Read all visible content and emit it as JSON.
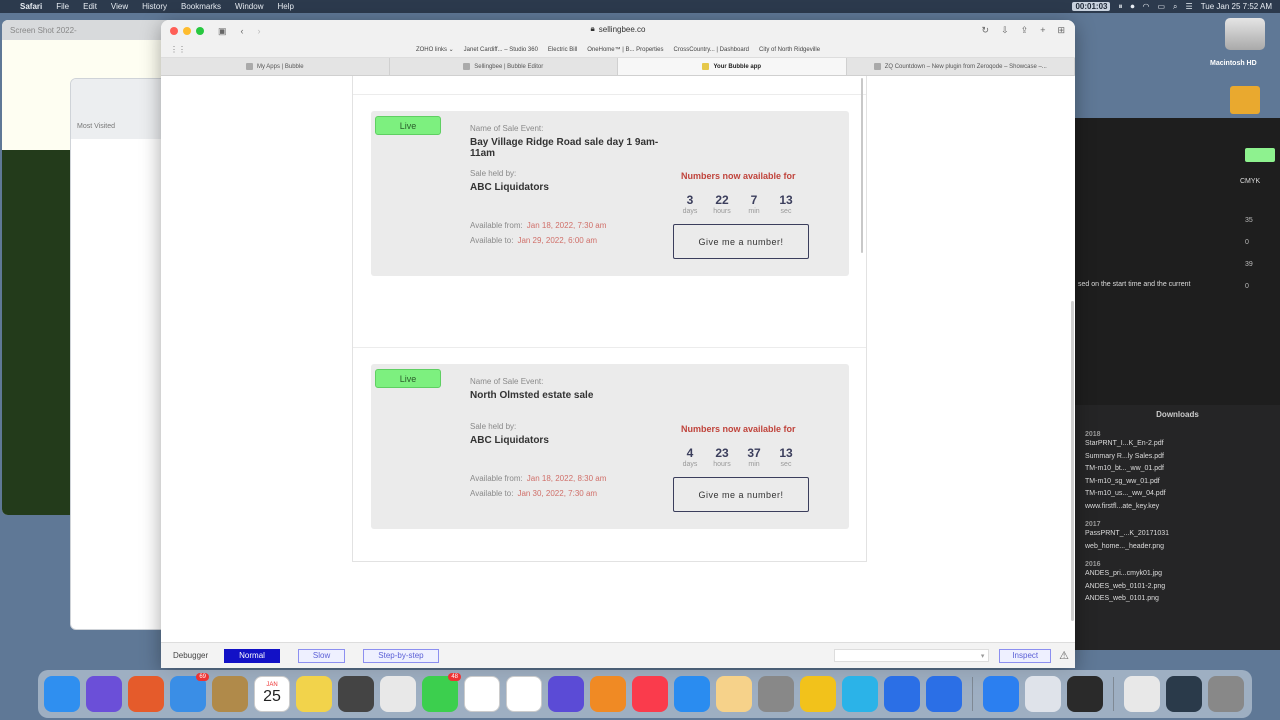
{
  "menubar": {
    "app": "Safari",
    "items": [
      "File",
      "Edit",
      "View",
      "History",
      "Bookmarks",
      "Window",
      "Help"
    ],
    "recording_time": "00:01:03",
    "clock": "Tue Jan 25  7:52 AM"
  },
  "desktop": {
    "bg_window_title": "Screen Shot 2022-",
    "bg_window_tab": "Most Visited",
    "disk_label": "Macintosh HD",
    "right_panel_text": "sed on the start time and the current",
    "cmyk_label": "CMYK",
    "right_numbers": [
      "35",
      "0",
      "39",
      "0"
    ],
    "downloads": {
      "title": "Downloads",
      "groups": [
        {
          "year": "2018",
          "files": [
            "StarPRNT_I...K_En-2.pdf",
            "Summary R...ly Sales.pdf",
            "TM-m10_bt..._ww_01.pdf",
            "TM-m10_sg_ww_01.pdf",
            "TM-m10_us..._ww_04.pdf",
            "www.firstfl...ate_key.key"
          ]
        },
        {
          "year": "2017",
          "files": [
            "PassPRNT_...K_20171031",
            "web_home..._header.png"
          ]
        },
        {
          "year": "2016",
          "files": [
            "ANDES_pri...cmyk01.jpg",
            "ANDES_web_0101-2.png",
            "ANDES_web_0101.png"
          ]
        }
      ]
    }
  },
  "safari": {
    "url": "sellingbee.co",
    "favorites": [
      "ZOHO links ⌄",
      "Janet Cardiff... – Studio 360",
      "Electric Bill",
      "OneHome™ | B... Properties",
      "CrossCountry... | Dashboard",
      "City of North Ridgeville"
    ],
    "tabs": [
      {
        "label": "My Apps | Bubble",
        "active": false
      },
      {
        "label": "Sellingbee | Bubble Editor",
        "active": false
      },
      {
        "label": "Your Bubble app",
        "active": true
      },
      {
        "label": "ZQ Countdown – New plugin from Zeroqode – Showcase –...",
        "active": false
      }
    ]
  },
  "events": [
    {
      "status": "Live",
      "name_label": "Name of Sale Event:",
      "name": "Bay Village Ridge Road sale day 1 9am-11am",
      "held_by_label": "Sale held by:",
      "held_by": "ABC Liquidators",
      "from_label": "Available from:",
      "from": "Jan 18, 2022, 7:30 am",
      "to_label": "Available to:",
      "to": "Jan 29, 2022, 6:00 am",
      "avail_heading": "Numbers now available for",
      "countdown": [
        {
          "num": "3",
          "unit": "days"
        },
        {
          "num": "22",
          "unit": "hours"
        },
        {
          "num": "7",
          "unit": "min"
        },
        {
          "num": "13",
          "unit": "sec"
        }
      ],
      "button": "Give me a number!"
    },
    {
      "status": "Live",
      "name_label": "Name of Sale Event:",
      "name": "North Olmsted estate sale",
      "held_by_label": "Sale held by:",
      "held_by": "ABC Liquidators",
      "from_label": "Available from:",
      "from": "Jan 18, 2022, 8:30 am",
      "to_label": "Available to:",
      "to": "Jan 30, 2022, 7:30 am",
      "avail_heading": "Numbers now available for",
      "countdown": [
        {
          "num": "4",
          "unit": "days"
        },
        {
          "num": "23",
          "unit": "hours"
        },
        {
          "num": "37",
          "unit": "min"
        },
        {
          "num": "13",
          "unit": "sec"
        }
      ],
      "button": "Give me a number!"
    }
  ],
  "debugger": {
    "label": "Debugger",
    "normal": "Normal",
    "slow": "Slow",
    "step": "Step-by-step",
    "inspect": "Inspect"
  },
  "dock": {
    "mail_badge": "69",
    "messages_badge": "48",
    "calendar_month": "JAN",
    "calendar_day": "25",
    "icon_colors": [
      "#2f8ff0",
      "#6b4fd8",
      "#e55b2b",
      "#3a8ee6",
      "#b08a4a",
      "#ffffff",
      "#f2d34b",
      "#444444",
      "#e8e8e8",
      "#3ccf4e",
      "#ffffff",
      "#ffffff",
      "#5b4bd6",
      "#f08a24",
      "#fa3b4c",
      "#2a8cf0",
      "#f6d28a",
      "#888888",
      "#f2c21b",
      "#2bb3e8",
      "#2b6fe6",
      "#2b6fe6",
      "#2b7ff0",
      "#dfe3ea",
      "#2a2a2a",
      "#e8e8e8",
      "#2a3a4a",
      "#888888"
    ]
  }
}
